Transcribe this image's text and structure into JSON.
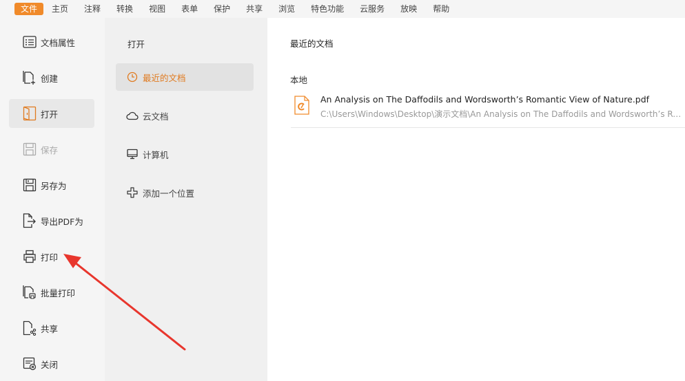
{
  "menubar": {
    "items": [
      {
        "label": "文件",
        "active": true
      },
      {
        "label": "主页"
      },
      {
        "label": "注释"
      },
      {
        "label": "转换"
      },
      {
        "label": "视图"
      },
      {
        "label": "表单"
      },
      {
        "label": "保护"
      },
      {
        "label": "共享"
      },
      {
        "label": "浏览"
      },
      {
        "label": "特色功能"
      },
      {
        "label": "云服务"
      },
      {
        "label": "放映"
      },
      {
        "label": "帮助"
      }
    ]
  },
  "file_menu": {
    "items": [
      {
        "label": "文档属性",
        "icon": "document-properties-icon"
      },
      {
        "label": "创建",
        "icon": "create-document-icon"
      },
      {
        "label": "打开",
        "icon": "open-folder-icon",
        "selected": true
      },
      {
        "label": "保存",
        "icon": "save-icon",
        "disabled": true
      },
      {
        "label": "另存为",
        "icon": "save-as-icon"
      },
      {
        "label": "导出PDF为",
        "icon": "export-pdf-icon"
      },
      {
        "label": "打印",
        "icon": "printer-icon"
      },
      {
        "label": "批量打印",
        "icon": "batch-print-icon"
      },
      {
        "label": "共享",
        "icon": "share-icon"
      },
      {
        "label": "关闭",
        "icon": "close-document-icon"
      }
    ]
  },
  "open_panel": {
    "title": "打开",
    "items": [
      {
        "label": "最近的文档",
        "icon": "clock-icon",
        "selected": true
      },
      {
        "label": "云文档",
        "icon": "cloud-icon"
      },
      {
        "label": "计算机",
        "icon": "computer-icon"
      },
      {
        "label": "添加一个位置",
        "icon": "add-location-icon"
      }
    ]
  },
  "content": {
    "title": "最近的文档",
    "section": "本地",
    "files": [
      {
        "name": "An Analysis on The Daffodils and Wordsworth’s Romantic View of Nature.pdf",
        "path": "C:\\Users\\Windows\\Desktop\\演示文档\\An Analysis on The Daffodils and Wordsworth’s Romantic View of Nature.pdf",
        "icon": "pdf-file-icon"
      }
    ]
  },
  "colors": {
    "accent": "#f08a2a",
    "arrow": "#e8362d"
  }
}
